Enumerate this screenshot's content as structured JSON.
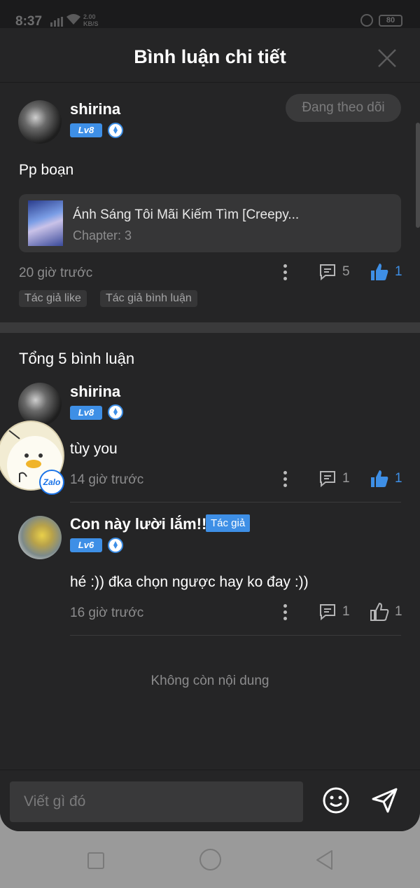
{
  "status_bar": {
    "time": "8:37",
    "speed": "2.00\nKB/S",
    "battery": "80"
  },
  "header": {
    "title": "Bình luận chi tiết"
  },
  "main_comment": {
    "username": "shirina",
    "level": "Lv8",
    "follow_label": "Đang theo dõi",
    "text": "Pp boạn",
    "book": {
      "title": "Ánh Sáng Tôi Mãi Kiếm Tìm [Creepy...",
      "chapter": "Chapter: 3"
    },
    "time": "20 giờ trước",
    "reply_count": "5",
    "like_count": "1",
    "tags": [
      "Tác giả like",
      "Tác giả bình luận"
    ]
  },
  "replies_section": {
    "title": "Tổng 5 bình luận"
  },
  "replies": [
    {
      "username": "shirina",
      "level": "Lv8",
      "text": "tùy you",
      "time": "14 giờ trước",
      "reply_count": "1",
      "like_count": "1",
      "liked": true
    },
    {
      "username": "Con này lười lắm!!",
      "author_tag": "Tác giả",
      "level": "Lv6",
      "text": "hé :)) đka chọn ngược hay ko đay :))",
      "time": "16 giờ trước",
      "reply_count": "1",
      "like_count": "1",
      "liked": false
    }
  ],
  "end_text": "Không còn nội dung",
  "composer": {
    "placeholder": "Viết gì đó"
  },
  "zalo": {
    "label": "Zalo"
  },
  "colors": {
    "accent": "#3e8fe6",
    "background": "#252526"
  }
}
